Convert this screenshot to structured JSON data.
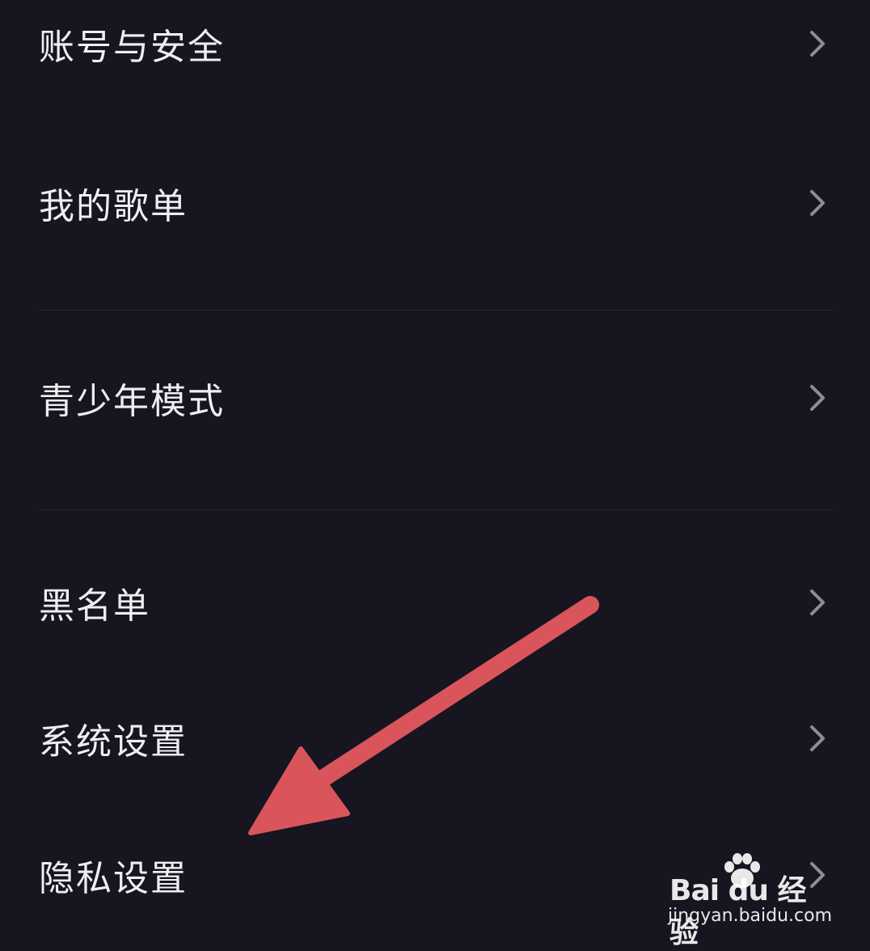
{
  "menu": {
    "items": [
      {
        "label": "账号与安全"
      },
      {
        "label": "我的歌单"
      },
      {
        "label": "青少年模式"
      },
      {
        "label": "黑名单"
      },
      {
        "label": "系统设置"
      },
      {
        "label": "隐私设置"
      }
    ]
  },
  "icons": {
    "chevron": "chevron-right-icon",
    "annotation": "arrow-icon"
  },
  "colors": {
    "background": "#17151f",
    "text": "#eeeef2",
    "chevron": "#8e8c96",
    "annotation_arrow": "#d9555b"
  },
  "watermark": {
    "brand": "Bai du 经验",
    "url": "jingyan.baidu.com"
  }
}
